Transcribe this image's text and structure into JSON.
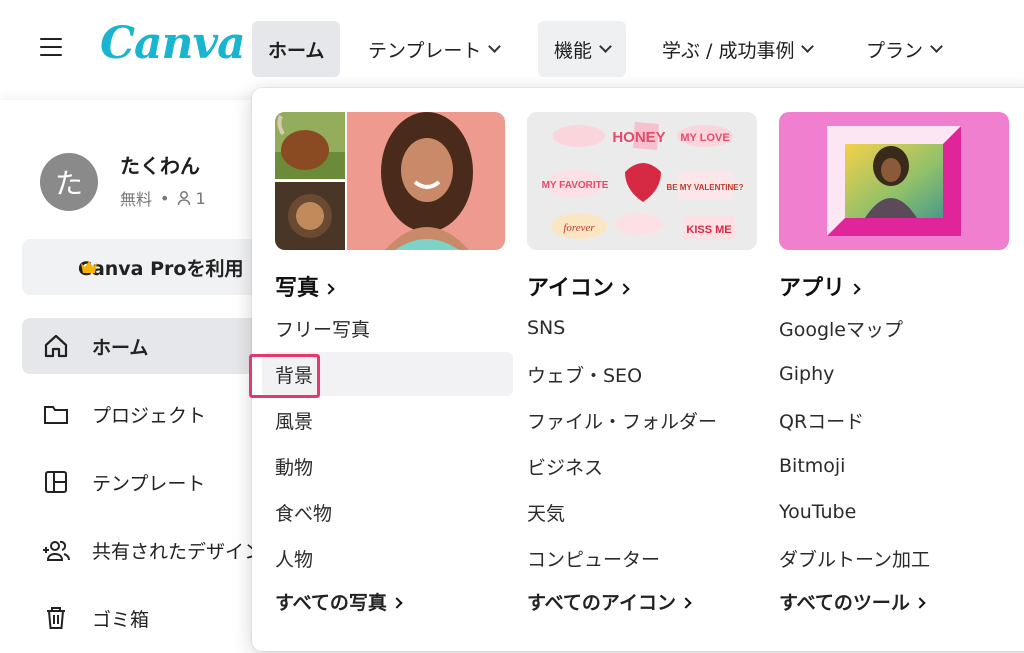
{
  "header": {
    "logo": "Canva",
    "nav": [
      {
        "label": "ホーム",
        "dropdown": false,
        "state": "active"
      },
      {
        "label": "テンプレート",
        "dropdown": true,
        "state": "normal"
      },
      {
        "label": "機能",
        "dropdown": true,
        "state": "hover"
      },
      {
        "label": "学ぶ / 成功事例",
        "dropdown": true,
        "state": "normal"
      },
      {
        "label": "プラン",
        "dropdown": true,
        "state": "normal"
      }
    ]
  },
  "sidebar": {
    "avatar_initial": "た",
    "user_name": "たくわん",
    "plan_label": "無料",
    "member_count": "1",
    "pro_button": "Canva Proを利用",
    "items": [
      {
        "label": "ホーム",
        "icon": "home-icon",
        "active": true
      },
      {
        "label": "プロジェクト",
        "icon": "folder-icon",
        "active": false
      },
      {
        "label": "テンプレート",
        "icon": "template-icon",
        "active": false
      },
      {
        "label": "共有されたデザイン",
        "icon": "shared-users-icon",
        "active": false
      },
      {
        "label": "ゴミ箱",
        "icon": "trash-icon",
        "active": false
      }
    ]
  },
  "dropdown": {
    "columns": [
      {
        "title": "写真",
        "links": [
          "フリー写真",
          "背景",
          "風景",
          "動物",
          "食べ物",
          "人物"
        ],
        "highlighted_index": 1,
        "all_link": "すべての写真"
      },
      {
        "title": "アイコン",
        "links": [
          "SNS",
          "ウェブ・SEO",
          "ファイル・フォルダー",
          "ビジネス",
          "天気",
          "コンピューター"
        ],
        "all_link": "すべてのアイコン",
        "sticker_texts": [
          "HONEY",
          "MY LOVE",
          "MY FAVORITE",
          "BE MY VALENTINE?",
          "KISS ME",
          "forever"
        ]
      },
      {
        "title": "アプリ",
        "links": [
          "Googleマップ",
          "Giphy",
          "QRコード",
          "Bitmoji",
          "YouTube",
          "ダブルトーン加工"
        ],
        "all_link": "すべてのツール"
      }
    ]
  },
  "colors": {
    "accent_purple": "#7b4dea",
    "accent_teal": "#18b5d0",
    "highlight_box": "#e23a6f",
    "active_bg": "#e6e7ea"
  }
}
